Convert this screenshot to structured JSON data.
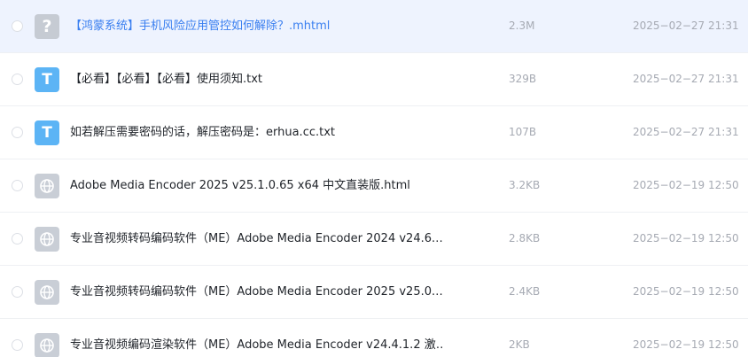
{
  "files": [
    {
      "icon": "question-icon",
      "icon_glyph": "?",
      "name": "【鸿蒙系统】手机风险应用管控如何解除？.mhtml",
      "size": "2.3M",
      "date": "2025−02−27 21:31",
      "selected": true
    },
    {
      "icon": "text-file-icon",
      "icon_glyph": "T",
      "name": "【必看】【必看】【必看】使用须知.txt",
      "size": "329B",
      "date": "2025−02−27 21:31",
      "selected": false
    },
    {
      "icon": "text-file-icon",
      "icon_glyph": "T",
      "name": "如若解压需要密码的话，解压密码是：erhua.cc.txt",
      "size": "107B",
      "date": "2025−02−27 21:31",
      "selected": false
    },
    {
      "icon": "web-file-icon",
      "icon_glyph": "",
      "name": "Adobe Media Encoder 2025 v25.1.0.65 x64 中文直装版.html",
      "size": "3.2KB",
      "date": "2025−02−19 12:50",
      "selected": false
    },
    {
      "icon": "web-file-icon",
      "icon_glyph": "",
      "name": "专业音视频转码编码软件（ME）Adobe Media Encoder 2024 v24.6.…",
      "size": "2.8KB",
      "date": "2025−02−19 12:50",
      "selected": false
    },
    {
      "icon": "web-file-icon",
      "icon_glyph": "",
      "name": "专业音视频转码编码软件（ME）Adobe Media Encoder 2025 v25.0.…",
      "size": "2.4KB",
      "date": "2025−02−19 12:50",
      "selected": false
    },
    {
      "icon": "web-file-icon",
      "icon_glyph": "",
      "name": "专业音视频编码渲染软件（ME）Adobe Media Encoder v24.4.1.2 激…",
      "size": "2KB",
      "date": "2025−02−19 12:50",
      "selected": false
    }
  ]
}
